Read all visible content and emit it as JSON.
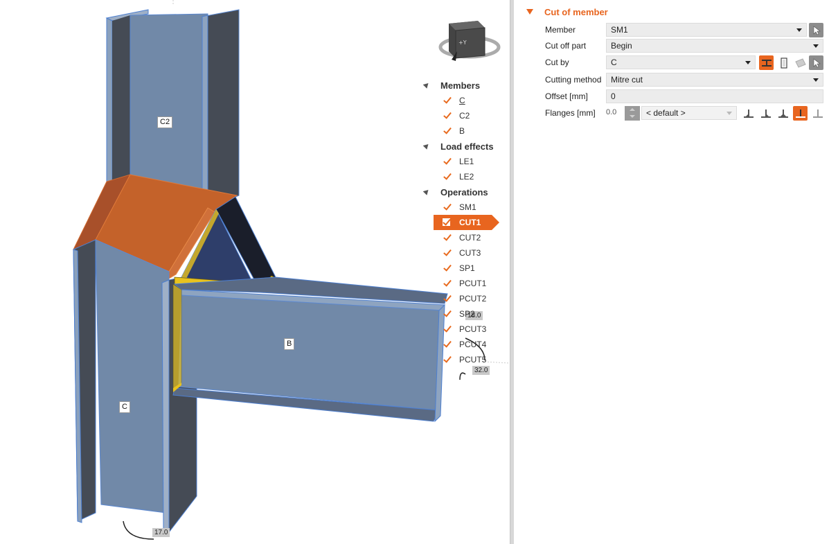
{
  "viewport": {
    "members": [
      {
        "label": "C2"
      },
      {
        "label": "B"
      },
      {
        "label": "C"
      }
    ],
    "dimensions": [
      "18.0",
      "32.0",
      "17.0"
    ],
    "navcube": {
      "axis_label": "+Y"
    }
  },
  "tree": {
    "groups": [
      {
        "label": "Members",
        "items": [
          {
            "label": "C",
            "underline": true
          },
          {
            "label": "C2"
          },
          {
            "label": "B"
          }
        ]
      },
      {
        "label": "Load effects",
        "items": [
          {
            "label": "LE1"
          },
          {
            "label": "LE2"
          }
        ]
      },
      {
        "label": "Operations",
        "items": [
          {
            "label": "SM1"
          },
          {
            "label": "CUT1",
            "selected": true
          },
          {
            "label": "CUT2"
          },
          {
            "label": "CUT3"
          },
          {
            "label": "SP1"
          },
          {
            "label": "PCUT1"
          },
          {
            "label": "PCUT2"
          },
          {
            "label": "SP2"
          },
          {
            "label": "PCUT3"
          },
          {
            "label": "PCUT4"
          },
          {
            "label": "PCUT5"
          }
        ]
      }
    ]
  },
  "properties": {
    "section_title": "Cut of member",
    "rows": {
      "member": {
        "label": "Member",
        "value": "SM1"
      },
      "cut_off_part": {
        "label": "Cut off part",
        "value": "Begin"
      },
      "cut_by": {
        "label": "Cut by",
        "value": "C"
      },
      "cutting_method": {
        "label": "Cutting method",
        "value": "Mitre cut"
      },
      "offset": {
        "label": "Offset [mm]",
        "value": "0"
      },
      "flanges": {
        "label": "Flanges [mm]",
        "value": "0.0",
        "weld_type": "< default >"
      }
    }
  },
  "colors": {
    "accent": "#e8651f",
    "steel": "#7189a8",
    "steel_dark": "#454b55",
    "plate": "#c4622a",
    "weld": "#e8c21e"
  }
}
